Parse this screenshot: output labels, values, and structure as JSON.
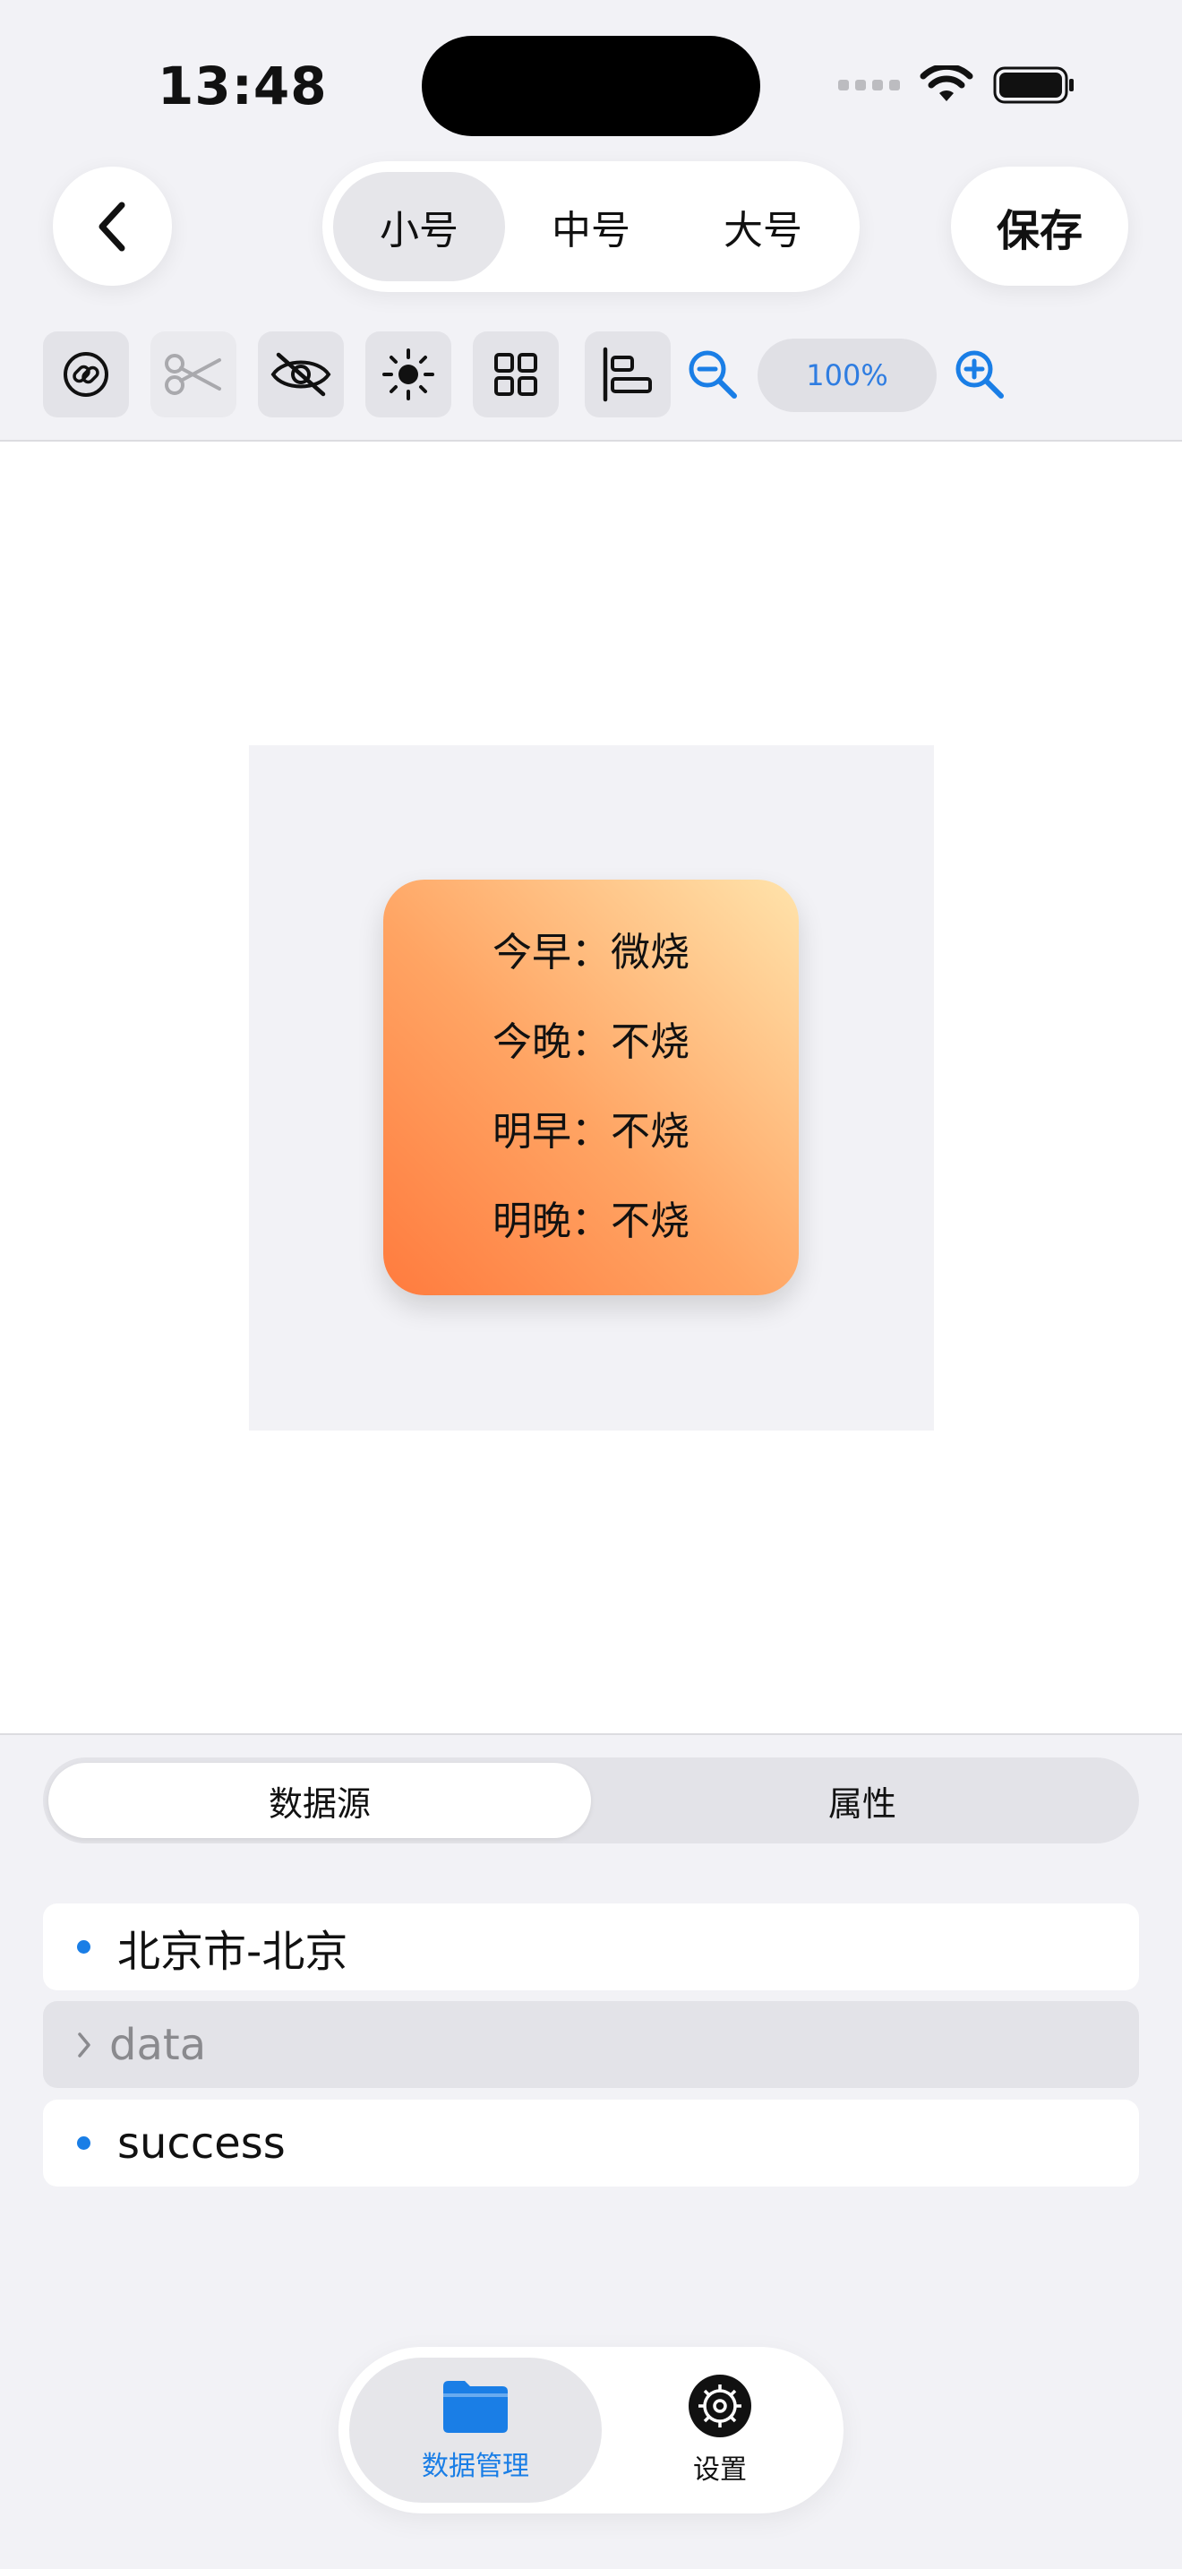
{
  "status_bar": {
    "time": "13:48"
  },
  "header": {
    "back_icon": "chevron-left-icon",
    "size_options": [
      "小号",
      "中号",
      "大号"
    ],
    "selected_size": "小号",
    "save_label": "保存"
  },
  "toolbar": {
    "tools": [
      "link-icon",
      "scissors-icon",
      "eye-slash-icon",
      "sun-icon",
      "grid-icon",
      "align-left-icon"
    ],
    "disabled_tools": [
      "scissors-icon"
    ],
    "zoom_out_icon": "zoom-out-icon",
    "zoom_level": "100%",
    "zoom_in_icon": "zoom-in-icon"
  },
  "widget": {
    "lines": [
      "今早：微烧",
      "今晚：不烧",
      "明早：不烧",
      "明晚：不烧"
    ],
    "gradient_colors": [
      "#ff7b3e",
      "#ffa463",
      "#ffe3ab"
    ]
  },
  "panel": {
    "tabs": [
      "数据源",
      "属性"
    ],
    "active_tab": "数据源",
    "rows": [
      {
        "text": "北京市-北京",
        "kind": "leaf"
      },
      {
        "text": "data",
        "kind": "collapsed-group"
      },
      {
        "text": "success",
        "kind": "leaf"
      }
    ]
  },
  "tabbar": {
    "items": [
      {
        "label": "数据管理",
        "icon": "folder-icon",
        "active": true
      },
      {
        "label": "设置",
        "icon": "gear-icon",
        "active": false
      }
    ]
  },
  "colors": {
    "accent": "#1a7ee6",
    "zoom_text": "#2f7de1"
  }
}
